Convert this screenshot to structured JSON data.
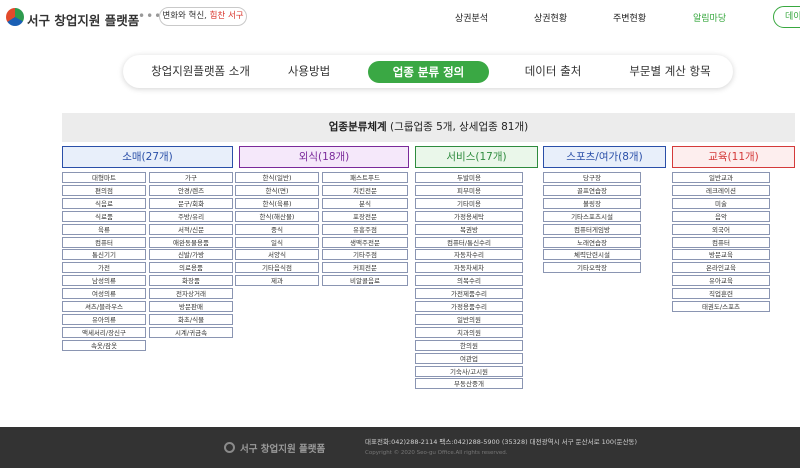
{
  "header": {
    "logo_text": "서구 창업지원 플랫폼",
    "logo_dots": "•••",
    "slogan_part1": "변화와 혁신,",
    "slogan_part2": "힘찬 서구",
    "nav": [
      {
        "label": "상권분석"
      },
      {
        "label": "상권현황"
      },
      {
        "label": "주변현황"
      },
      {
        "label": "알림마당"
      }
    ],
    "nav_button": "데이",
    "active_color": "#38a83f"
  },
  "tabs": [
    {
      "label": "창업지원플랫폼 소개"
    },
    {
      "label": "사용방법"
    },
    {
      "label": "업종 분류 정의"
    },
    {
      "label": "데이터 출처"
    },
    {
      "label": "부문별 계산 항목"
    }
  ],
  "title": {
    "bold": "업종분류체계",
    "rest": " (그룹업종 5개, 상세업종 81개)"
  },
  "categories": [
    {
      "name": "소매",
      "count": "(27개)",
      "color": "#2a4fa8",
      "bg": "#e8effa",
      "items": [
        "대형마트",
        "가구",
        "편의점",
        "안경/렌즈",
        "식음료",
        "문구/회화",
        "식료품",
        "주방/유리",
        "육류",
        "서적/신문",
        "컴퓨터",
        "애완동물용품",
        "통신기기",
        "신발/가방",
        "가전",
        "의료용품",
        "남성의류",
        "화장품",
        "여성의류",
        "전자상거래",
        "셔츠/블라우스",
        "방문판매",
        "유아의류",
        "화초/식물",
        "액세서리/장신구",
        "시계/귀금속",
        "속옷/잠옷"
      ]
    },
    {
      "name": "외식",
      "count": "(18개)",
      "color": "#7a2a9a",
      "bg": "#f5e8fa",
      "items": [
        "한식(일반)",
        "패스트푸드",
        "한식(면)",
        "치킨전문",
        "한식(육류)",
        "분식",
        "한식(해산물)",
        "포장전문",
        "중식",
        "유흥주점",
        "일식",
        "생맥주전문",
        "서양식",
        "기타주점",
        "기타음식점",
        "커피전문",
        "제과",
        "비알콜음료"
      ]
    },
    {
      "name": "서비스",
      "count": "(17개)",
      "color": "#2e8b3e",
      "bg": "#eaf7ea",
      "items": [
        "두발미용",
        "피부미용",
        "기타미용",
        "가정용세탁",
        "복권방",
        "컴퓨터/통신수리",
        "자동차수리",
        "자동차세차",
        "의복수리",
        "가전제품수리",
        "가정용품수리",
        "일반의원",
        "치과의원",
        "한의원",
        "여관업",
        "기숙사/고시원",
        "부동산중개"
      ]
    },
    {
      "name": "스포츠/여가",
      "count": "(8개)",
      "color": "#2a4fa8",
      "bg": "#e8effa",
      "items": [
        "당구장",
        "골프연습장",
        "볼링장",
        "기타스포츠시설",
        "컴퓨터게임방",
        "노래연습장",
        "체력단련시설",
        "기타오락장"
      ]
    },
    {
      "name": "교육",
      "count": "(11개)",
      "color": "#d43a3a",
      "bg": "#fdeeee",
      "items": [
        "일반교과",
        "레크레이션",
        "미술",
        "음악",
        "외국어",
        "컴퓨터",
        "방문교육",
        "온라인교육",
        "유아교육",
        "직업훈련",
        "태권도/스포츠"
      ]
    }
  ],
  "footer": {
    "logo_text": "서구 창업지원 플랫폼",
    "contact": "대표전화:042)288-2114    팩스:042)288-5900    (35328) 대전광역시 서구 둔산서로 100(둔산동)",
    "copyright": "Copyright © 2020 Seo-gu Office.All rights reserved."
  }
}
